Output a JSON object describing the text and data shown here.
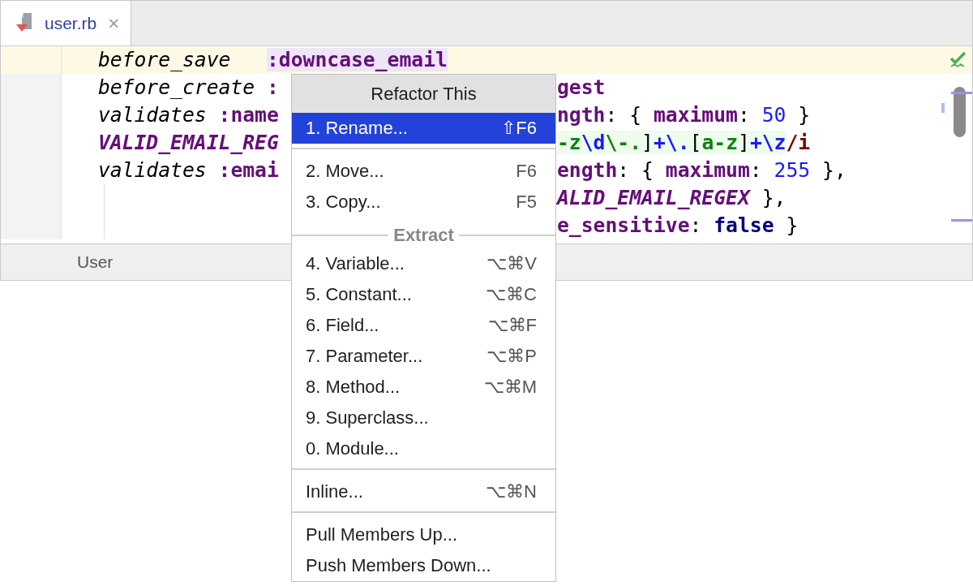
{
  "tabs": [
    {
      "label": "user.rb",
      "selected": true,
      "close": "×"
    }
  ],
  "code_lines": [
    {
      "current": true,
      "left": [
        {
          "kind": "method",
          "text": "before_save   "
        },
        {
          "kind": "symbol-usage",
          "text": ":downcase_email"
        }
      ]
    },
    {
      "current": false,
      "left": [
        {
          "kind": "method",
          "text": "before_create "
        },
        {
          "kind": "symbol",
          "text": ":"
        }
      ],
      "right": [
        {
          "kind": "symbol",
          "text": "gest"
        }
      ]
    },
    {
      "current": false,
      "left": [
        {
          "kind": "method",
          "text": "validates "
        },
        {
          "kind": "symbol",
          "text": ":name"
        }
      ],
      "right": [
        {
          "kind": "symbol",
          "text": "ngth"
        },
        {
          "kind": "punct",
          "text": ": { "
        },
        {
          "kind": "symbol",
          "text": "maximum"
        },
        {
          "kind": "punct",
          "text": ": "
        },
        {
          "kind": "number",
          "text": "50"
        },
        {
          "kind": "punct",
          "text": " }"
        }
      ]
    },
    {
      "current": false,
      "left": [
        {
          "kind": "constant",
          "text": "VALID_EMAIL_REG"
        }
      ],
      "right": [
        {
          "kind": "regex-class",
          "text": "-z"
        },
        {
          "kind": "regex-escape",
          "text": "\\d"
        },
        {
          "kind": "regex-class",
          "text": "\\-."
        },
        {
          "kind": "regex-punct",
          "text": "]"
        },
        {
          "kind": "regex-escape",
          "text": "+\\."
        },
        {
          "kind": "regex-punct",
          "text": "["
        },
        {
          "kind": "regex-class",
          "text": "a-z"
        },
        {
          "kind": "regex-punct",
          "text": "]"
        },
        {
          "kind": "regex-escape",
          "text": "+\\z"
        },
        {
          "kind": "regex-end",
          "text": "/i"
        }
      ]
    },
    {
      "current": false,
      "left": [
        {
          "kind": "method",
          "text": "validates "
        },
        {
          "kind": "symbol",
          "text": ":emai"
        }
      ],
      "right": [
        {
          "kind": "symbol",
          "text": "ength"
        },
        {
          "kind": "punct",
          "text": ": { "
        },
        {
          "kind": "symbol",
          "text": "maximum"
        },
        {
          "kind": "punct",
          "text": ": "
        },
        {
          "kind": "number",
          "text": "255"
        },
        {
          "kind": "punct",
          "text": " },"
        }
      ]
    },
    {
      "current": false,
      "right": [
        {
          "kind": "constant",
          "text": "ALID_EMAIL_REGEX"
        },
        {
          "kind": "punct",
          "text": " },"
        }
      ]
    },
    {
      "current": false,
      "right": [
        {
          "kind": "symbol",
          "text": "e_sensitive"
        },
        {
          "kind": "punct",
          "text": ": "
        },
        {
          "kind": "keyword",
          "text": "false"
        },
        {
          "kind": "punct",
          "text": " }"
        }
      ]
    }
  ],
  "status_bar": {
    "breadcrumb": "User"
  },
  "popup": {
    "title": "Refactor This",
    "sections": [
      {
        "items": [
          {
            "label": "1. Rename...",
            "shortcut": "⇧F6",
            "selected": true
          }
        ]
      },
      {
        "items": [
          {
            "label": "2. Move...",
            "shortcut": "F6",
            "selected": false
          },
          {
            "label": "3. Copy...",
            "shortcut": "F5",
            "selected": false
          }
        ]
      },
      {
        "heading": "Extract",
        "items": [
          {
            "label": "4. Variable...",
            "shortcut": "⌥⌘V",
            "selected": false
          },
          {
            "label": "5. Constant...",
            "shortcut": "⌥⌘C",
            "selected": false
          },
          {
            "label": "6. Field...",
            "shortcut": "⌥⌘F",
            "selected": false
          },
          {
            "label": "7. Parameter...",
            "shortcut": "⌥⌘P",
            "selected": false
          },
          {
            "label": "8. Method...",
            "shortcut": "⌥⌘M",
            "selected": false
          },
          {
            "label": "9. Superclass...",
            "selected": false
          },
          {
            "label": "0. Module...",
            "selected": false
          }
        ]
      },
      {
        "items": [
          {
            "label": "Inline...",
            "shortcut": "⌥⌘N",
            "selected": false
          }
        ]
      },
      {
        "items": [
          {
            "label": "Pull Members Up...",
            "selected": false
          },
          {
            "label": "Push Members Down...",
            "selected": false
          }
        ]
      }
    ]
  }
}
